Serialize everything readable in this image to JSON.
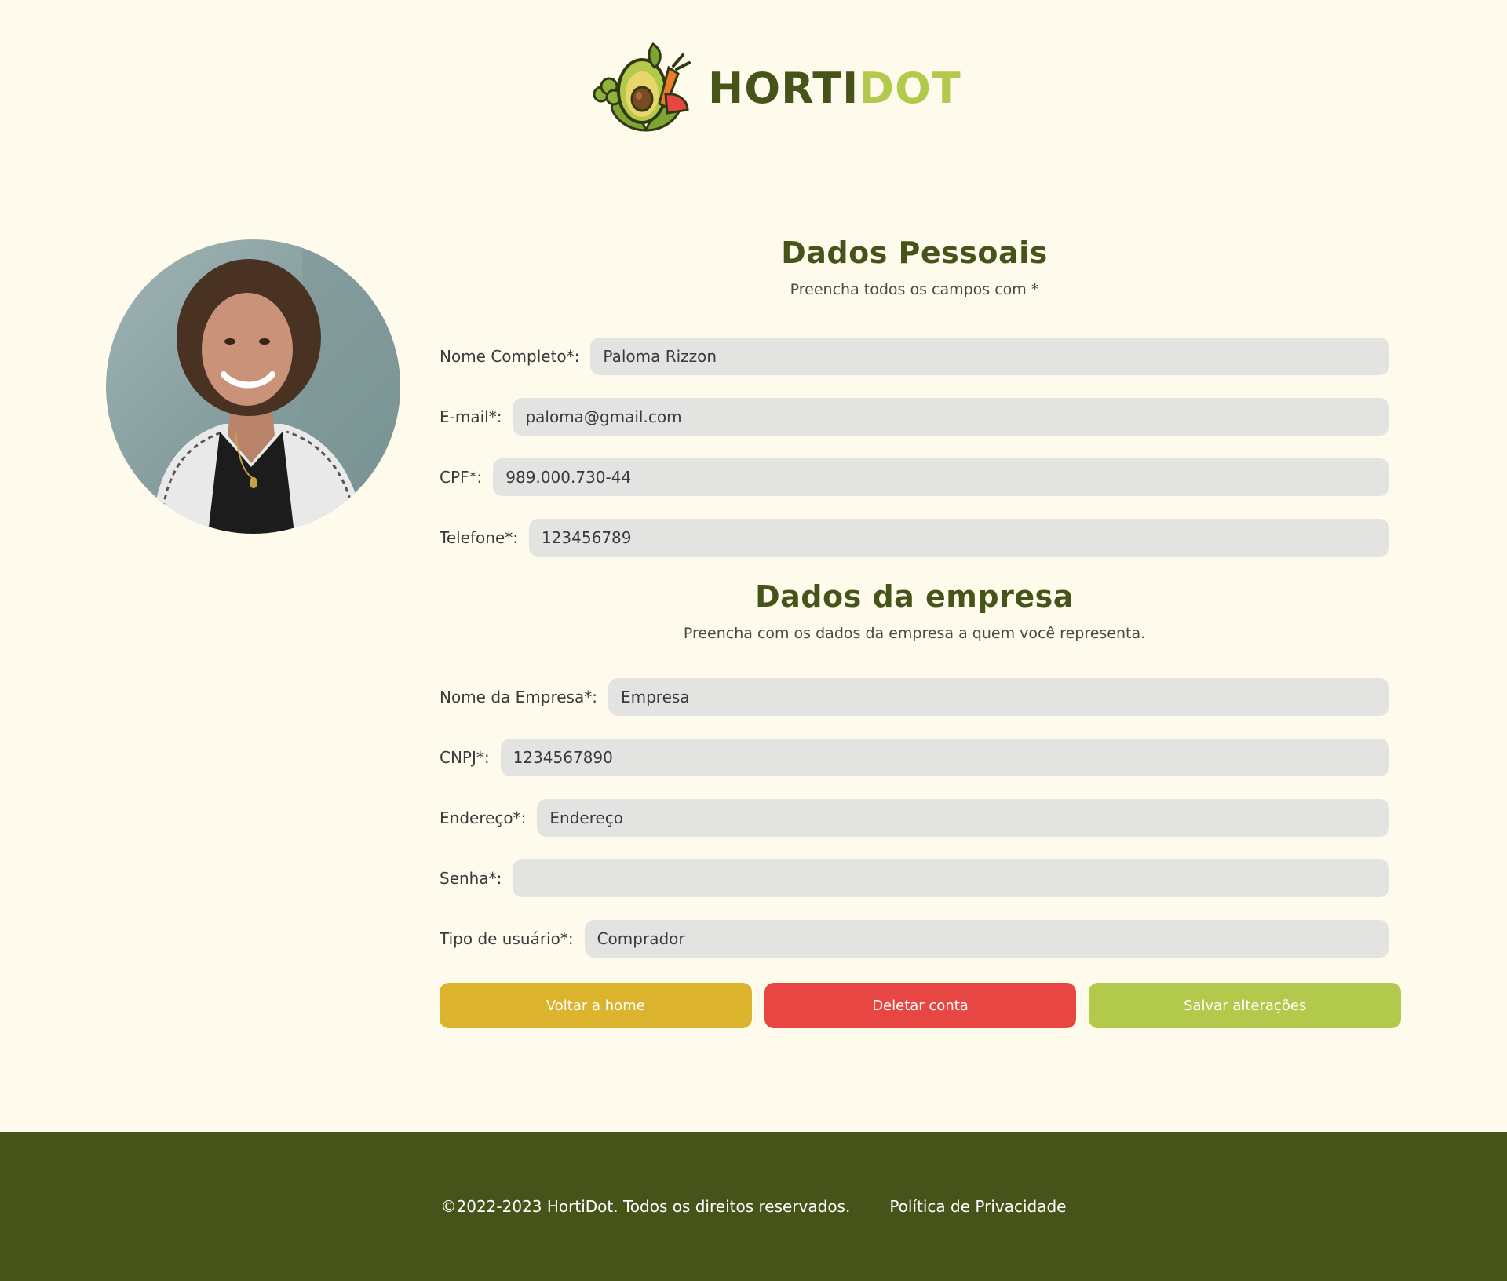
{
  "brand": {
    "name_part1": "HORTI",
    "name_part2": "DOT",
    "color_dark": "#465419",
    "color_light": "#b3c94b"
  },
  "personal": {
    "title": "Dados Pessoais",
    "subtitle": "Preencha todos os campos com *",
    "fields": [
      {
        "label": "Nome Completo*:",
        "value": "Paloma Rizzon"
      },
      {
        "label": "E-mail*:",
        "value": "paloma@gmail.com"
      },
      {
        "label": "CPF*:",
        "value": "989.000.730-44"
      },
      {
        "label": "Telefone*:",
        "value": "123456789"
      }
    ]
  },
  "company": {
    "title": "Dados da empresa",
    "subtitle": "Preencha com os dados da empresa a quem você representa.",
    "fields": [
      {
        "label": "Nome da Empresa*:",
        "value": "Empresa"
      },
      {
        "label": "CNPJ*:",
        "value": "1234567890"
      },
      {
        "label": "Endereço*:",
        "value": "Endereço"
      },
      {
        "label": "Senha*:",
        "value": ""
      },
      {
        "label": "Tipo de usuário*:",
        "value": "Comprador"
      }
    ]
  },
  "buttons": {
    "home": "Voltar a home",
    "delete": "Deletar conta",
    "save": "Salvar alterações",
    "colors": {
      "home": "#dcb32d",
      "delete": "#e74642",
      "save": "#b3c94b"
    }
  },
  "footer": {
    "copyright": "©2022-2023 HortiDot. Todos os direitos reservados.",
    "privacy": "Política de Privacidade"
  }
}
